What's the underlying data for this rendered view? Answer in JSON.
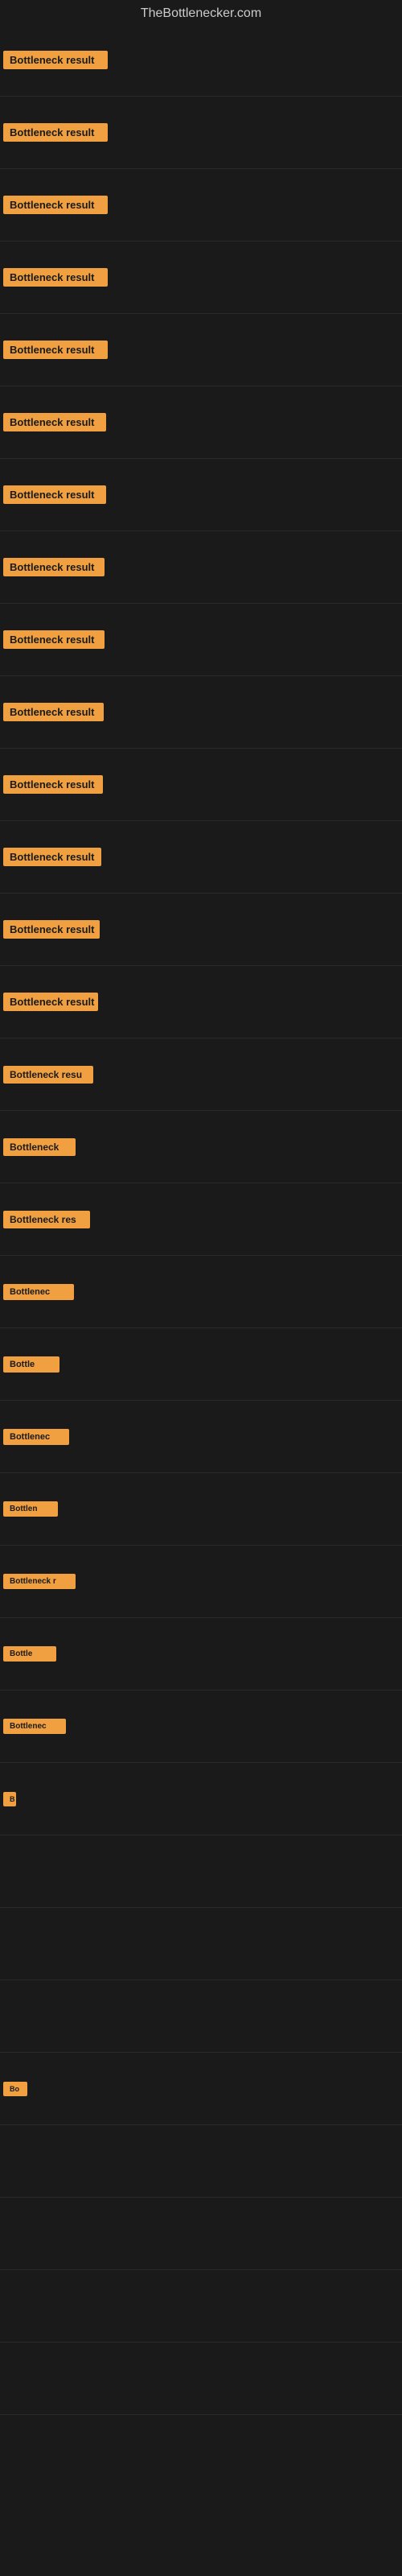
{
  "site": {
    "title": "TheBottlenecker.com"
  },
  "rows": [
    {
      "id": 1,
      "badge": "Bottleneck result"
    },
    {
      "id": 2,
      "badge": "Bottleneck result"
    },
    {
      "id": 3,
      "badge": "Bottleneck result"
    },
    {
      "id": 4,
      "badge": "Bottleneck result"
    },
    {
      "id": 5,
      "badge": "Bottleneck result"
    },
    {
      "id": 6,
      "badge": "Bottleneck result"
    },
    {
      "id": 7,
      "badge": "Bottleneck result"
    },
    {
      "id": 8,
      "badge": "Bottleneck result"
    },
    {
      "id": 9,
      "badge": "Bottleneck result"
    },
    {
      "id": 10,
      "badge": "Bottleneck result"
    },
    {
      "id": 11,
      "badge": "Bottleneck result"
    },
    {
      "id": 12,
      "badge": "Bottleneck result"
    },
    {
      "id": 13,
      "badge": "Bottleneck result"
    },
    {
      "id": 14,
      "badge": "Bottleneck result"
    },
    {
      "id": 15,
      "badge": "Bottleneck resu"
    },
    {
      "id": 16,
      "badge": "Bottleneck"
    },
    {
      "id": 17,
      "badge": "Bottleneck res"
    },
    {
      "id": 18,
      "badge": "Bottlenec"
    },
    {
      "id": 19,
      "badge": "Bottle"
    },
    {
      "id": 20,
      "badge": "Bottlenec"
    },
    {
      "id": 21,
      "badge": "Bottlen"
    },
    {
      "id": 22,
      "badge": "Bottleneck r"
    },
    {
      "id": 23,
      "badge": "Bottle"
    },
    {
      "id": 24,
      "badge": "Bottlenec"
    },
    {
      "id": 25,
      "badge": "B"
    },
    {
      "id": 26,
      "badge": ""
    },
    {
      "id": 27,
      "badge": ""
    },
    {
      "id": 28,
      "badge": ""
    },
    {
      "id": 29,
      "badge": "Bo"
    },
    {
      "id": 30,
      "badge": ""
    },
    {
      "id": 31,
      "badge": ""
    },
    {
      "id": 32,
      "badge": ""
    },
    {
      "id": 33,
      "badge": ""
    }
  ]
}
